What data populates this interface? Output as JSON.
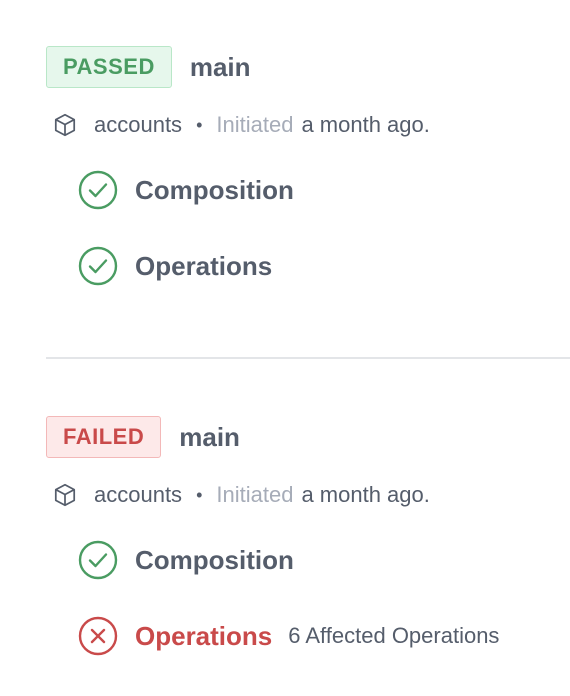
{
  "builds": [
    {
      "status": "PASSED",
      "branch": "main",
      "repo": "accounts",
      "separator": "•",
      "initiated_label": "Initiated",
      "initiated_time": "a month ago.",
      "checks": [
        {
          "label": "Composition",
          "state": "pass"
        },
        {
          "label": "Operations",
          "state": "pass"
        }
      ]
    },
    {
      "status": "FAILED",
      "branch": "main",
      "repo": "accounts",
      "separator": "•",
      "initiated_label": "Initiated",
      "initiated_time": "a month ago.",
      "checks": [
        {
          "label": "Composition",
          "state": "pass"
        },
        {
          "label": "Operations",
          "state": "fail",
          "note": "6 Affected Operations"
        }
      ]
    }
  ],
  "colors": {
    "pass": "#4a9c62",
    "fail": "#c94a4a",
    "text": "#555d6b",
    "muted": "#a6acb8"
  },
  "icons": {
    "repo": "cube-icon",
    "pass": "check-circle-icon",
    "fail": "x-circle-icon"
  }
}
